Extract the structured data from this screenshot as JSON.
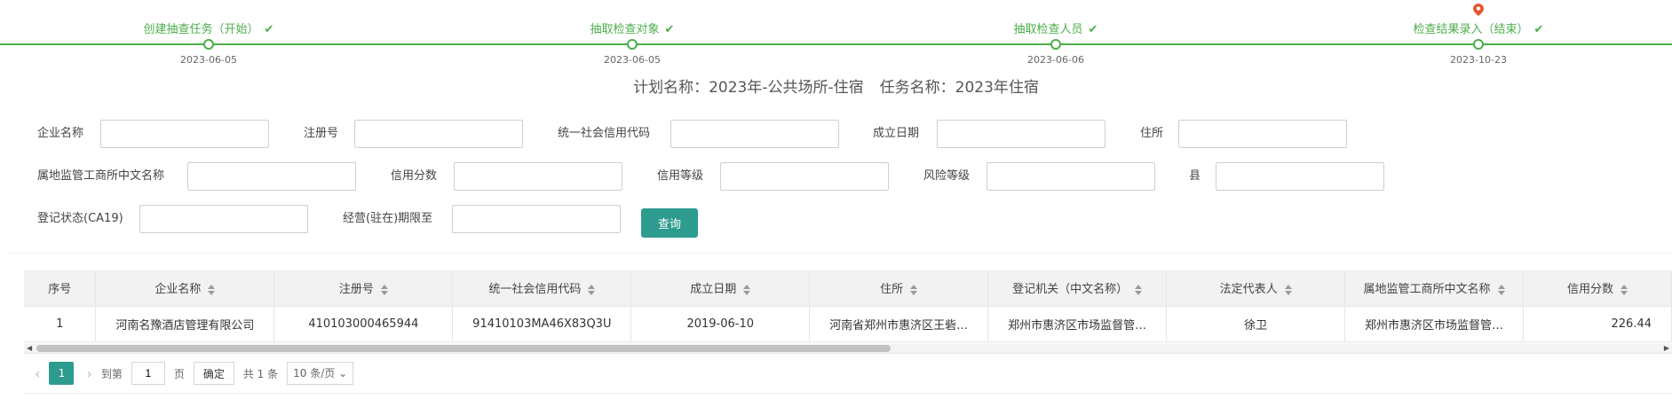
{
  "steps": [
    {
      "label": "创建抽查任务（开始）",
      "date": "2023-06-05"
    },
    {
      "label": "抽取检查对象",
      "date": "2023-06-05"
    },
    {
      "label": "抽取检查人员",
      "date": "2023-06-06"
    },
    {
      "label": "检查结果录入（结束）",
      "date": "2023-10-23"
    }
  ],
  "plan": {
    "plan_name": "计划名称：2023年-公共场所-住宿",
    "task_name": "任务名称：2023年住宿"
  },
  "form": {
    "company_name": "企业名称",
    "reg_no": "注册号",
    "credit_code": "统一社会信用代码",
    "found_date": "成立日期",
    "address": "住所",
    "authority": "属地监管工商所中文名称",
    "credit_score": "信用分数",
    "credit_level": "信用等级",
    "risk_level": "风险等级",
    "county": "县",
    "reg_status": "登记状态(CA19)",
    "biz_term": "经营(驻在)期限至",
    "query_button": "查询"
  },
  "table": {
    "headers": [
      "序号",
      "企业名称",
      "注册号",
      "统一社会信用代码",
      "成立日期",
      "住所",
      "登记机关（中文名称）",
      "法定代表人",
      "属地监管工商所中文名称",
      "信用分数"
    ],
    "rows": [
      [
        "1",
        "河南名豫酒店管理有限公司",
        "410103000465944",
        "91410103MA46X83Q3U",
        "2019-06-10",
        "河南省郑州市惠济区王砦…",
        "郑州市惠济区市场监督管…",
        "徐卫",
        "郑州市惠济区市场监督管…",
        "226.44"
      ]
    ]
  },
  "pager": {
    "current_page": "1",
    "goto_label": "到第",
    "goto_value": "1",
    "page_unit": "页",
    "confirm": "确定",
    "total": "共 1 条",
    "page_size": "10 条/页"
  },
  "colors": {
    "accent": "#2e9b8f",
    "step_green": "#4cae4c",
    "pin_red": "#e4572e"
  }
}
